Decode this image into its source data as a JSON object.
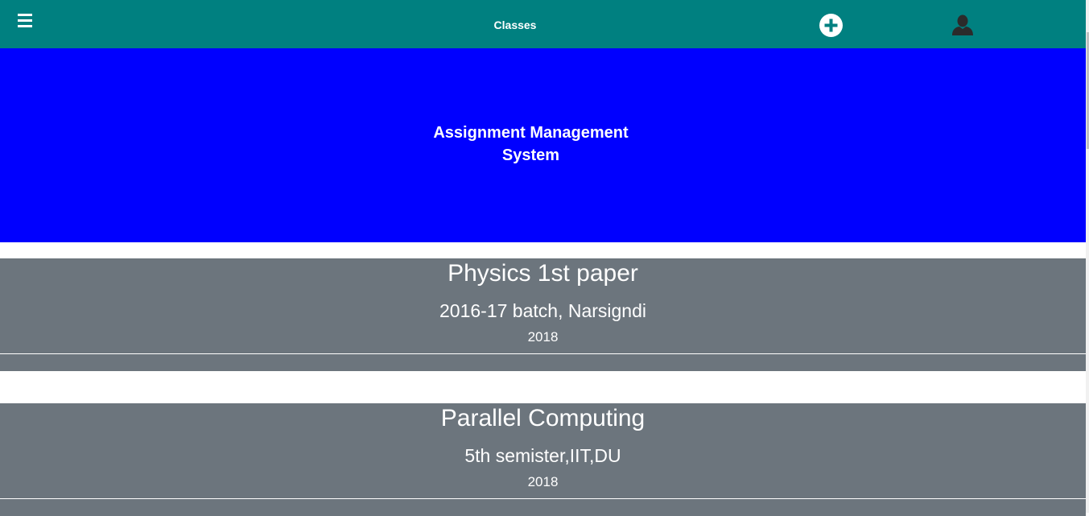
{
  "navbar": {
    "title": "Classes",
    "menu_icon": "hamburger-menu-icon",
    "add_icon": "plus-circle-icon",
    "user_icon": "user-icon",
    "color": "#008080"
  },
  "hero": {
    "title": "Assignment Management System",
    "color": "#0000ff"
  },
  "classes": [
    {
      "name": "Physics 1st paper",
      "batch": "2016-17 batch, Narsigndi",
      "year": "2018"
    },
    {
      "name": "Parallel Computing",
      "batch": "5th semister,IIT,DU",
      "year": "2018"
    }
  ],
  "card_color": "#6c757d"
}
